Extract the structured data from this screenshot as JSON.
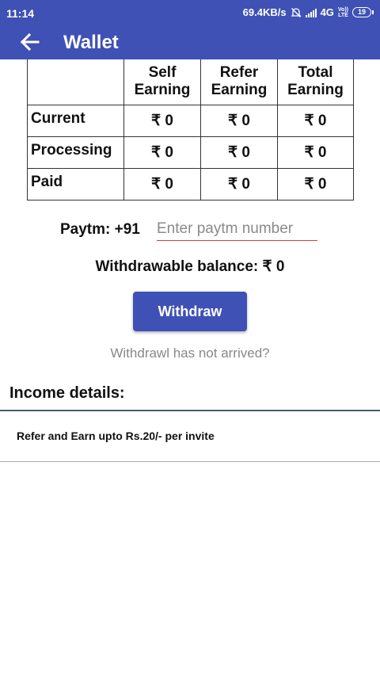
{
  "status_bar": {
    "time": "11:14",
    "speed": "69.4KB/s",
    "network": "4G",
    "volte_top": "Vo))",
    "volte_bottom": "LTE",
    "battery": "19"
  },
  "app_bar": {
    "title": "Wallet",
    "back_icon": "arrow-left-icon",
    "color": "#3f51b5"
  },
  "table": {
    "headers": [
      "",
      "Self\nEarning",
      "Refer\nEarning",
      "Total\nEarning"
    ],
    "rows": [
      {
        "label": "Current",
        "values": [
          "₹ 0",
          "₹ 0",
          "₹ 0"
        ]
      },
      {
        "label": "Processing",
        "values": [
          "₹ 0",
          "₹ 0",
          "₹ 0"
        ]
      },
      {
        "label": "Paid",
        "values": [
          "₹ 0",
          "₹ 0",
          "₹ 0"
        ]
      }
    ]
  },
  "paytm": {
    "label": "Paytm:  +91",
    "value": "",
    "placeholder": "Enter paytm number",
    "underline_color": "#e53935"
  },
  "balance": {
    "text": "Withdrawable balance: ₹ 0"
  },
  "withdraw_button": {
    "label": "Withdraw",
    "color": "#3f51b5"
  },
  "not_arrived_link": {
    "text": "Withdrawl has not arrived?"
  },
  "income": {
    "title": "Income details:",
    "items": [
      "Refer and Earn upto Rs.20/- per invite"
    ]
  }
}
